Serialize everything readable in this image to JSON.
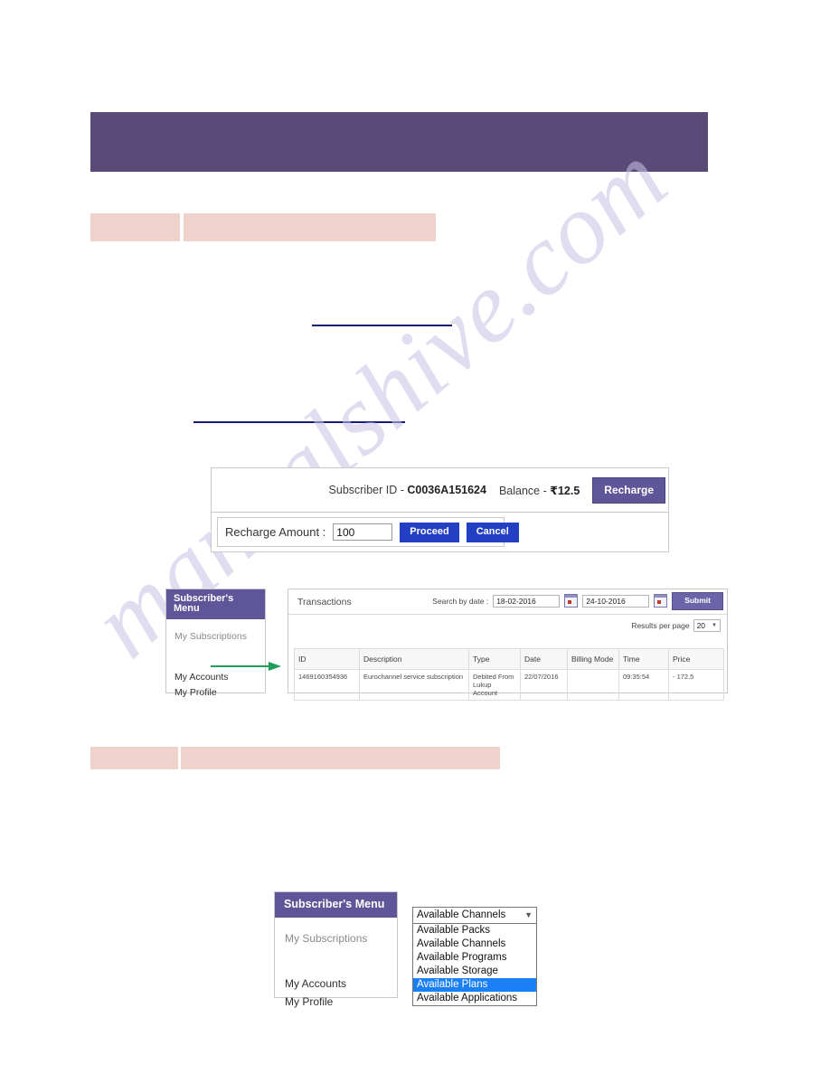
{
  "watermark": {
    "text": "manualshive.com"
  },
  "account_bar": {
    "subscriber_label": "Subscriber ID -",
    "subscriber_id": "C0036A151624",
    "balance_label": "Balance -",
    "currency_symbol": "₹",
    "balance_value": "12.5",
    "recharge_button": "Recharge"
  },
  "recharge_form": {
    "label": "Recharge Amount :",
    "amount_value": "100",
    "amount_placeholder": "",
    "proceed_button": "Proceed",
    "cancel_button": "Cancel"
  },
  "subscriber_menu": {
    "header": "Subscriber's Menu",
    "items": [
      {
        "label": "My Subscriptions"
      },
      {
        "label": "My Accounts"
      },
      {
        "label": "My Profile"
      }
    ]
  },
  "transactions": {
    "title": "Transactions",
    "search_label": "Search by date :",
    "date_from": "18-02-2016",
    "date_to": "24-10-2016",
    "submit_button": "Submit",
    "results_per_page_label": "Results per page",
    "results_per_page_value": "20",
    "columns": [
      "ID",
      "Description",
      "Type",
      "Date",
      "Billing Mode",
      "Time",
      "Price"
    ],
    "rows": [
      {
        "id": "1469160354936",
        "description": "Eurochannel service subscription",
        "type": "Debited From Lukup Account",
        "date": "22/07/2016",
        "billing_mode": "",
        "time": "09:35:54",
        "price": "- 172.5"
      }
    ]
  },
  "dropdown": {
    "selected": "Available Channels",
    "options": [
      {
        "label": "Available Packs",
        "highlighted": false
      },
      {
        "label": "Available Channels",
        "highlighted": false
      },
      {
        "label": "Available Programs",
        "highlighted": false
      },
      {
        "label": "Available Storage",
        "highlighted": false
      },
      {
        "label": "Available Plans",
        "highlighted": true
      },
      {
        "label": "Available Applications",
        "highlighted": false
      }
    ]
  },
  "colors": {
    "banner_purple": "#5a4a77",
    "menu_purple": "#5f5699",
    "button_blue": "#2340c4",
    "highlight_blue": "#1b7ff5",
    "pink_box": "#f0d2cd",
    "rule_navy": "#161d75",
    "arrow_green": "#1e9e5a",
    "price_red": "#c0392b",
    "id_link_blue": "#3b4fc0"
  }
}
